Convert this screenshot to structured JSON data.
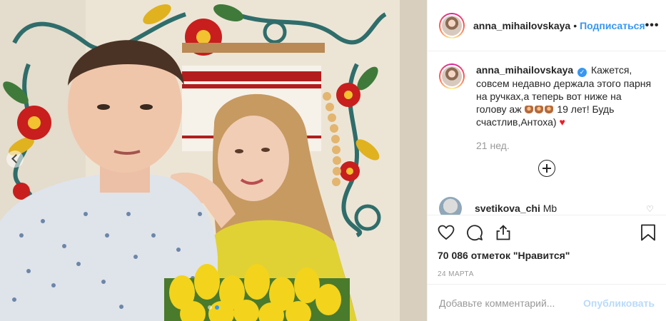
{
  "photo": {
    "alt_name": "selfie-photo"
  },
  "header": {
    "username": "anna_mihailovskaya",
    "separator": "•",
    "follow_label": "Подписаться",
    "more_label": "•••"
  },
  "caption": {
    "username": "anna_mihailovskaya",
    "verified_mark": "✓",
    "text_part1": " Кажется, совсем недавно держала этого парня на ручках,а теперь вот ниже на голову аж ",
    "text_part2": " 19 лет! Будь счастлив,Антоха) ",
    "heart": "♥",
    "time": "21 нед."
  },
  "comments": [
    {
      "username": "svetikova_chi",
      "text": "Mb"
    }
  ],
  "likes_text": "70 086 отметок \"Нравится\"",
  "date_text": "24 МАРТА",
  "comment_box": {
    "placeholder": "Добавьте комментарий...",
    "publish_label": "Опубликовать"
  },
  "icons": [
    "heart-icon",
    "comment-icon",
    "share-icon",
    "bookmark-icon",
    "plus-circle-icon",
    "chevron-left-icon"
  ],
  "colors": {
    "accent": "#3897f0",
    "heart": "#ed1c24",
    "muted": "#999999",
    "text": "#262626"
  }
}
